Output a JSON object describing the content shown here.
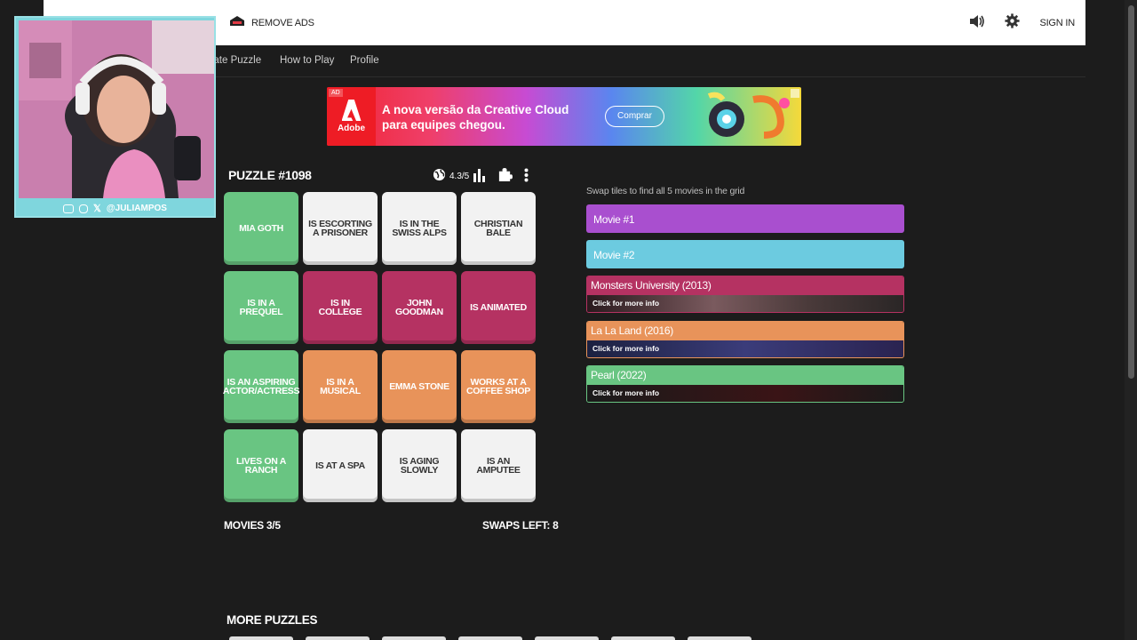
{
  "header": {
    "remove_ads": "REMOVE ADS",
    "sign_in": "SIGN IN"
  },
  "nav": {
    "items": [
      {
        "label": "eate Puzzle"
      },
      {
        "label": "How to Play"
      },
      {
        "label": "Profile"
      }
    ]
  },
  "ad": {
    "tag": "AD",
    "brand": "Adobe",
    "headline_line1": "A nova versão da Creative Cloud",
    "headline_line2": "para equipes chegou.",
    "cta": "Comprar"
  },
  "webcam": {
    "handle": "@JULIAMPOS"
  },
  "puzzle": {
    "title": "PUZZLE #1098",
    "rating": "4.3/5",
    "tiles": [
      {
        "label": "MIA GOTH",
        "color": "green"
      },
      {
        "label": "IS ESCORTING A PRISONER",
        "color": "white"
      },
      {
        "label": "IS IN THE SWISS ALPS",
        "color": "white"
      },
      {
        "label": "CHRISTIAN BALE",
        "color": "white"
      },
      {
        "label": "IS IN A PREQUEL",
        "color": "green"
      },
      {
        "label": "IS IN COLLEGE",
        "color": "wine"
      },
      {
        "label": "JOHN GOODMAN",
        "color": "wine"
      },
      {
        "label": "IS ANIMATED",
        "color": "wine"
      },
      {
        "label": "IS AN ASPIRING ACTOR/ACTRESS",
        "color": "green"
      },
      {
        "label": "IS IN A MUSICAL",
        "color": "orange"
      },
      {
        "label": "EMMA STONE",
        "color": "orange"
      },
      {
        "label": "WORKS AT A COFFEE SHOP",
        "color": "orange"
      },
      {
        "label": "LIVES ON A RANCH",
        "color": "green"
      },
      {
        "label": "IS AT A SPA",
        "color": "white"
      },
      {
        "label": "IS AGING SLOWLY",
        "color": "white"
      },
      {
        "label": "IS AN AMPUTEE",
        "color": "white"
      }
    ],
    "movies_count": "MOVIES 3/5",
    "swaps_left": "SWAPS LEFT: 8"
  },
  "panel": {
    "instructions": "Swap tiles to find all 5 movies in the grid",
    "slots": [
      {
        "title": "Movie #1",
        "status": "empty",
        "color": "#a94fcf"
      },
      {
        "title": "Movie #2",
        "status": "empty",
        "color": "#6ccbe0"
      },
      {
        "title": "Monsters University (2013)",
        "status": "found",
        "color": "#b53262",
        "info": "Click for more info"
      },
      {
        "title": "La La Land (2016)",
        "status": "found",
        "color": "#e8935a",
        "info": "Click for more info"
      },
      {
        "title": "Pearl (2022)",
        "status": "found",
        "color": "#69c582",
        "info": "Click for more info"
      }
    ]
  },
  "more_puzzles": "MORE PUZZLES",
  "colors": {
    "green": "#69c582",
    "white": "#f2f2f2",
    "wine": "#b53262",
    "orange": "#e8935a",
    "purple": "#a94fcf",
    "cyan": "#6ccbe0"
  }
}
